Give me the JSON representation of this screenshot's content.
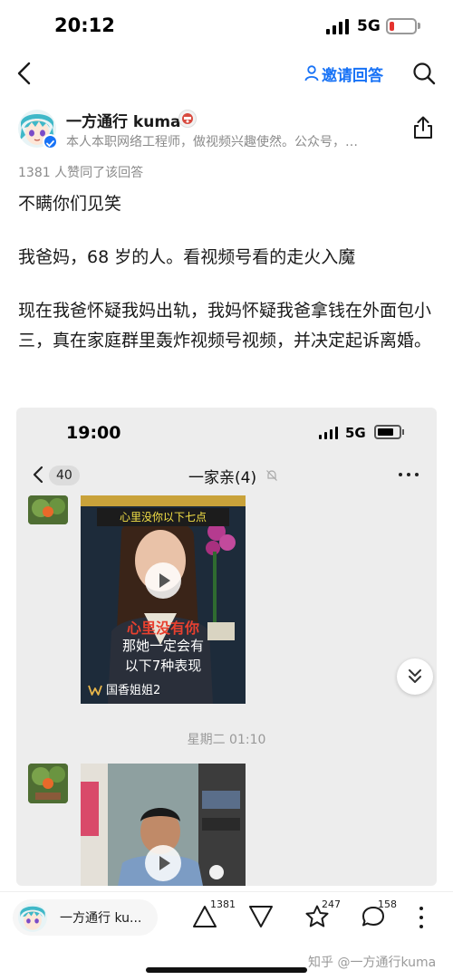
{
  "status_bar": {
    "time": "20:12",
    "network": "5G",
    "battery_color": "#e5332f"
  },
  "nav": {
    "invite_label": "邀请回答",
    "accent": "#1772f6"
  },
  "author": {
    "name": "一方通行 kuma",
    "description": "本人本职网络工程师，做视频兴趣使然。公众号，…"
  },
  "answer": {
    "likes_line": "1381 人赞同了该回答",
    "paragraphs": [
      "不瞒你们见笑",
      "我爸妈，68 岁的人。看视频号看的走火入魔",
      "现在我爸怀疑我妈出轨，我妈怀疑我爸拿钱在外面包小三，真在家庭群里轰炸视频号视频，并决定起诉离婚。"
    ]
  },
  "embedded_chat": {
    "time": "19:00",
    "network": "5G",
    "unread_count": "40",
    "group_title": "一家亲(4)",
    "video1": {
      "top_caption": "心里没你以下七点",
      "red_caption": "心里没有你",
      "white_line1": "那她一定会有",
      "white_line2": "以下7种表现",
      "source": "国香姐姐2"
    },
    "timestamp": "星期二 01:10"
  },
  "bottom_bar": {
    "author_short": "一方通行 ku...",
    "upvote_count": "1381",
    "favorite_count": "247",
    "comment_count": "158",
    "watermark": "知乎 @一方通行kuma"
  }
}
